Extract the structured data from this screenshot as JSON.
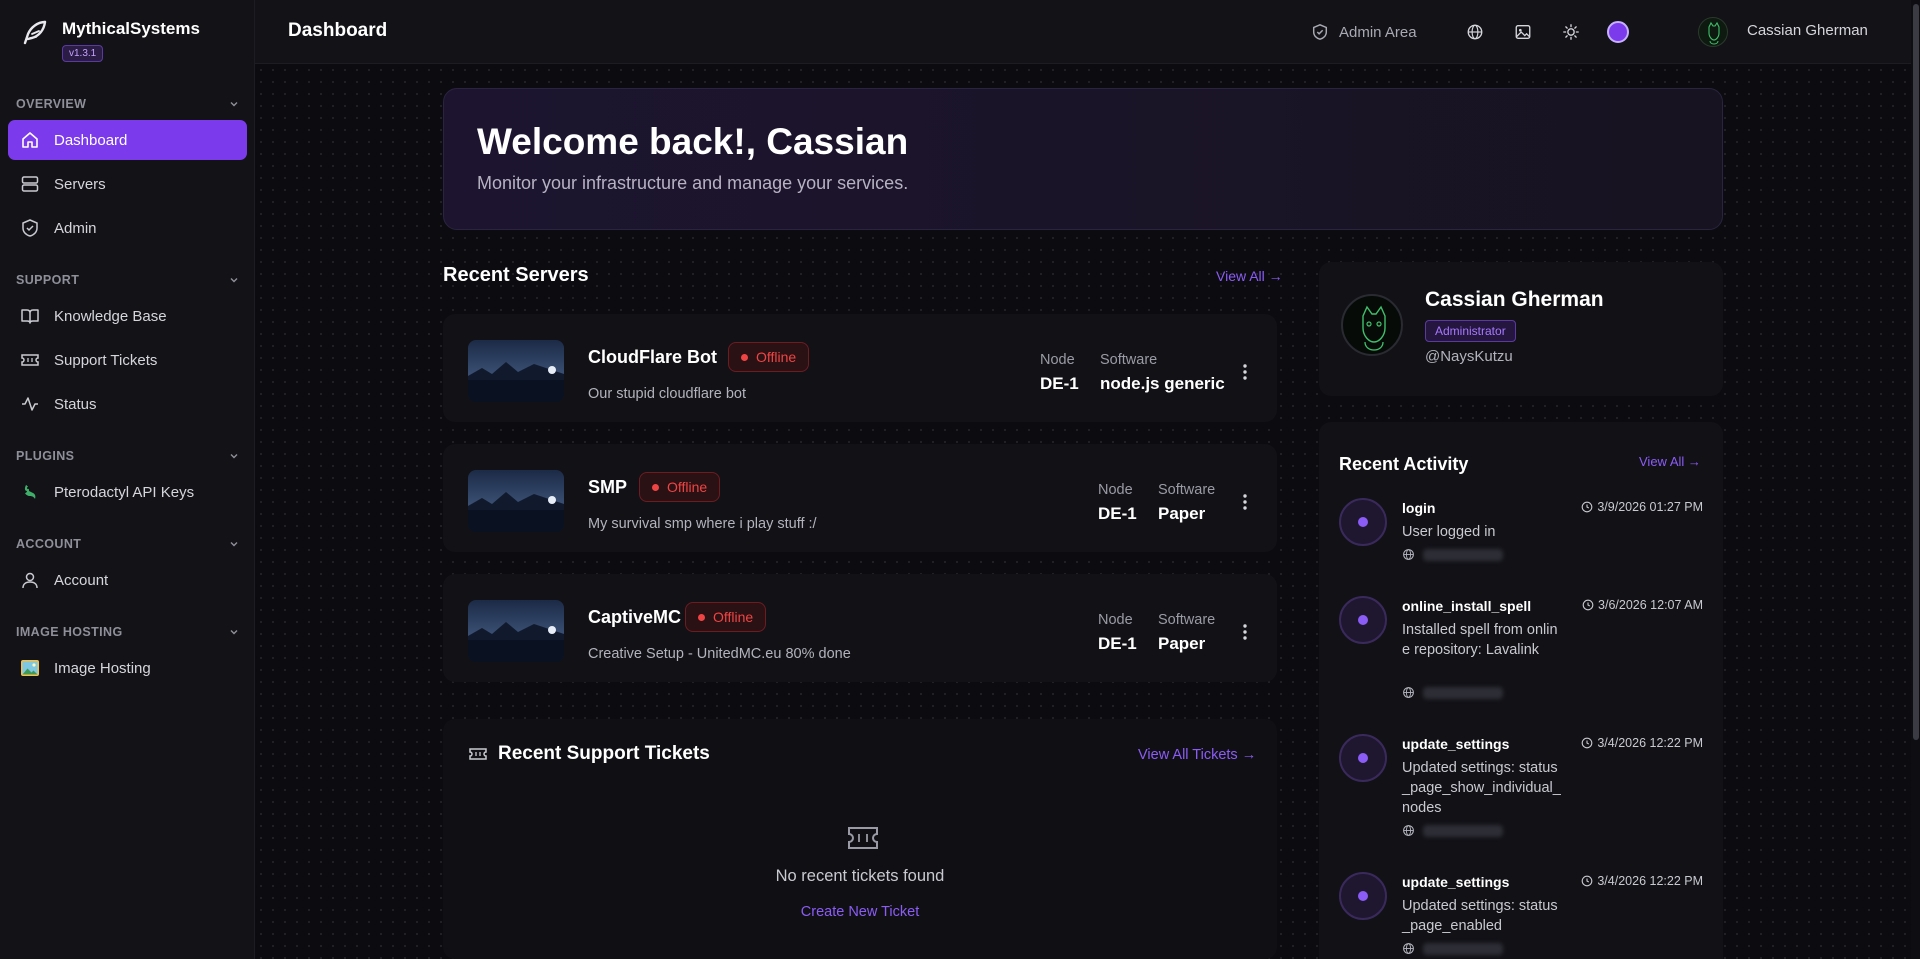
{
  "brand": {
    "name": "MythicalSystems",
    "version": "v1.3.1"
  },
  "sidebar": {
    "sections": [
      {
        "title": "OVERVIEW",
        "items": [
          {
            "label": "Dashboard",
            "icon": "home-icon",
            "active": true
          },
          {
            "label": "Servers",
            "icon": "server-icon"
          },
          {
            "label": "Admin",
            "icon": "shield-icon"
          }
        ]
      },
      {
        "title": "SUPPORT",
        "items": [
          {
            "label": "Knowledge Base",
            "icon": "book-icon"
          },
          {
            "label": "Support Tickets",
            "icon": "ticket-icon"
          },
          {
            "label": "Status",
            "icon": "activity-icon"
          }
        ]
      },
      {
        "title": "PLUGINS",
        "items": [
          {
            "label": "Pterodactyl API Keys",
            "icon": "pterodactyl-icon"
          }
        ]
      },
      {
        "title": "ACCOUNT",
        "items": [
          {
            "label": "Account",
            "icon": "user-icon"
          }
        ]
      },
      {
        "title": "IMAGE HOSTING",
        "items": [
          {
            "label": "Image Hosting",
            "icon": "image-hosting-icon"
          }
        ]
      }
    ]
  },
  "topbar": {
    "title": "Dashboard",
    "admin_area": "Admin Area",
    "user_name": "Cassian Gherman",
    "icons": [
      "globe-icon",
      "image-icon",
      "sun-icon",
      "theme-color-icon"
    ]
  },
  "welcome": {
    "title": "Welcome back!, Cassian",
    "subtitle": "Monitor your infrastructure and manage your services."
  },
  "recent_servers": {
    "title": "Recent Servers",
    "view_all": "View All →",
    "node_label": "Node",
    "software_label": "Software",
    "servers": [
      {
        "name": "CloudFlare Bot",
        "status": "Offline",
        "description": "Our stupid cloudflare bot",
        "node": "DE-1",
        "software": "node.js generic"
      },
      {
        "name": "SMP",
        "status": "Offline",
        "description": "My survival smp where i play stuff :/",
        "node": "DE-1",
        "software": "Paper"
      },
      {
        "name": "CaptiveMC",
        "status": "Offline",
        "description": "Creative Setup - UnitedMC.eu 80% done",
        "node": "DE-1",
        "software": "Paper"
      }
    ]
  },
  "tickets": {
    "title": "Recent Support Tickets",
    "view_all": "View All Tickets →",
    "empty": "No recent tickets found",
    "create": "Create New Ticket"
  },
  "profile": {
    "name": "Cassian Gherman",
    "role": "Administrator",
    "handle": "@NaysKutzu"
  },
  "activity": {
    "title": "Recent Activity",
    "view_all": "View All →",
    "items": [
      {
        "name": "login",
        "description": "User logged in",
        "time": "3/9/2026 01:27 PM"
      },
      {
        "name": "online_install_spell",
        "description": "Installed spell from online repository: Lavalink",
        "time": "3/6/2026 12:07 AM"
      },
      {
        "name": "update_settings",
        "description": "Updated settings: status_page_show_individual_nodes",
        "time": "3/4/2026 12:22 PM"
      },
      {
        "name": "update_settings",
        "description": "Updated settings: status_page_enabled",
        "time": "3/4/2026 12:22 PM"
      }
    ]
  },
  "colors": {
    "accent": "#7c3aed",
    "link": "#8b5cf6",
    "offline": "#ef4444",
    "background": "#0c0c10",
    "sidebar": "#121217"
  }
}
